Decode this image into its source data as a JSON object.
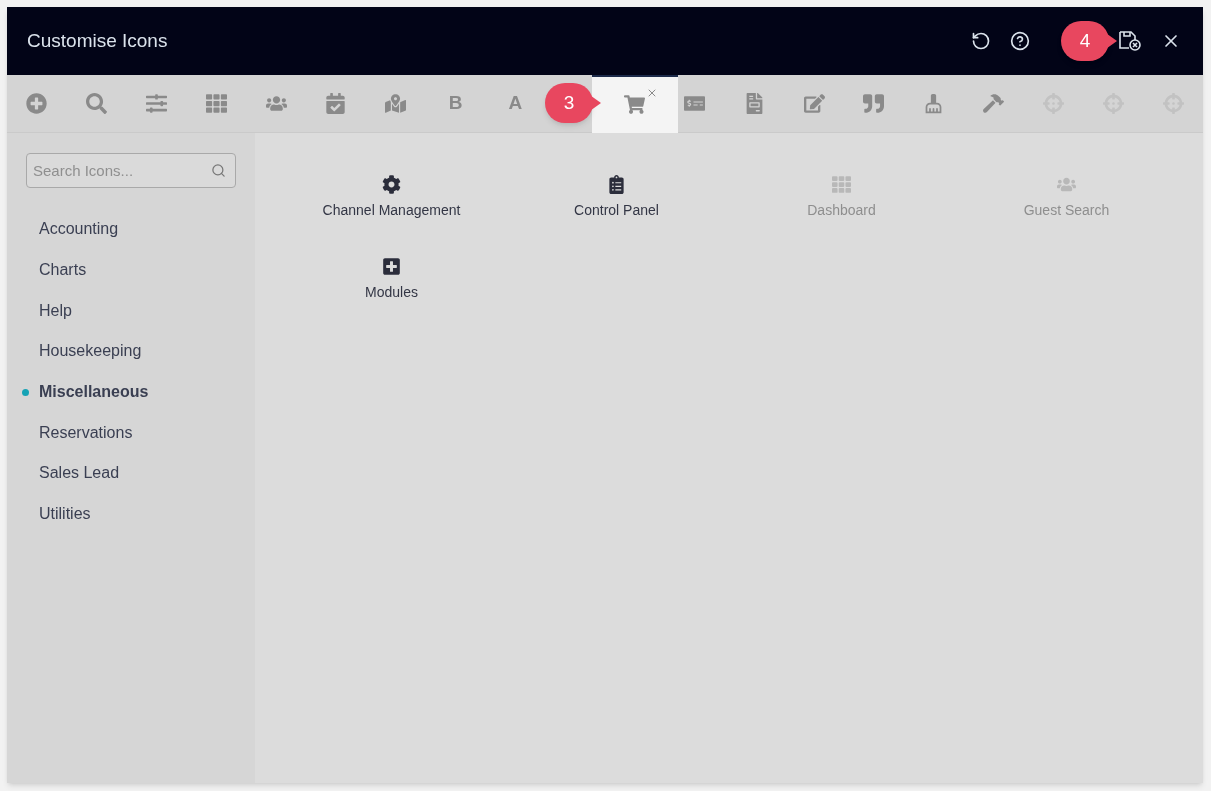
{
  "window": {
    "title": "Customise Icons"
  },
  "toolbar": [
    {
      "kind": "icon",
      "selected": false,
      "disabled": false
    },
    {
      "kind": "icon",
      "selected": false,
      "disabled": false
    },
    {
      "kind": "icon",
      "selected": false,
      "disabled": false
    },
    {
      "kind": "icon",
      "selected": false,
      "disabled": false
    },
    {
      "kind": "icon",
      "selected": false,
      "disabled": false
    },
    {
      "kind": "icon",
      "selected": false,
      "disabled": false
    },
    {
      "kind": "icon",
      "selected": false,
      "disabled": false
    },
    {
      "kind": "letter",
      "label": "B",
      "selected": false,
      "disabled": false
    },
    {
      "kind": "letter",
      "label": "A",
      "selected": false,
      "disabled": false
    },
    {
      "kind": "icon",
      "selected": true,
      "disabled": false
    },
    {
      "kind": "icon",
      "selected": false,
      "disabled": false
    },
    {
      "kind": "icon",
      "selected": false,
      "disabled": false
    },
    {
      "kind": "icon",
      "selected": false,
      "disabled": false
    },
    {
      "kind": "icon",
      "selected": false,
      "disabled": false
    },
    {
      "kind": "icon",
      "selected": false,
      "disabled": false
    },
    {
      "kind": "icon",
      "selected": false,
      "disabled": false
    },
    {
      "kind": "icon",
      "selected": false,
      "disabled": true
    },
    {
      "kind": "icon",
      "selected": false,
      "disabled": true
    },
    {
      "kind": "icon",
      "selected": false,
      "disabled": true
    }
  ],
  "sidebar": {
    "search": {
      "placeholder": "Search Icons..."
    },
    "items": [
      {
        "label": "Accounting",
        "selected": false
      },
      {
        "label": "Charts",
        "selected": false
      },
      {
        "label": "Help",
        "selected": false
      },
      {
        "label": "Housekeeping",
        "selected": false
      },
      {
        "label": "Miscellaneous",
        "selected": true
      },
      {
        "label": "Reservations",
        "selected": false
      },
      {
        "label": "Sales Lead",
        "selected": false
      },
      {
        "label": "Utilities",
        "selected": false
      }
    ]
  },
  "icons": [
    {
      "label": "Channel Management",
      "disabled": false
    },
    {
      "label": "Control Panel",
      "disabled": false
    },
    {
      "label": "Dashboard",
      "disabled": true
    },
    {
      "label": "Guest Search",
      "disabled": true
    },
    {
      "label": "Modules",
      "disabled": false
    }
  ],
  "annotations": [
    {
      "label": "3"
    },
    {
      "label": "4"
    }
  ]
}
